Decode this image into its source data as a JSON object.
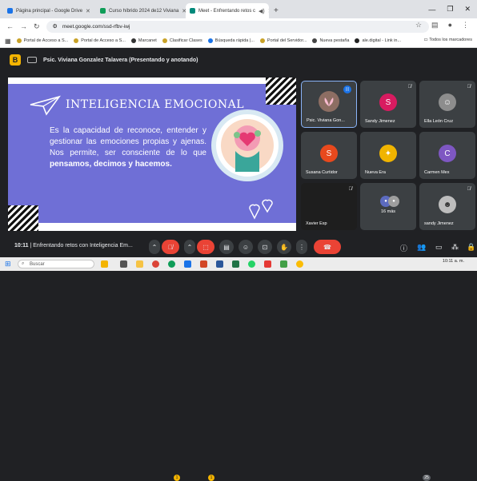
{
  "browser": {
    "tabs": [
      {
        "label": "Página principal - Google Drive",
        "color": "#1a73e8"
      },
      {
        "label": "Curso híbrido 2024 de12 Viviana",
        "color": "#0f9d58"
      },
      {
        "label": "Meet - Enfrentando retos c",
        "color": "#00897b",
        "active": true
      }
    ],
    "new_tab": "+",
    "url": "meet.google.com/ssd-rfbv-iwj",
    "bookmarks": [
      "Portal de Acceso a S...",
      "Portal de Acceso a S...",
      "Marcanet",
      "Clasificar Clases",
      "Búsqueda rápida |...",
      "Portal del Servidor...",
      "Nueva pestaña",
      "ale.digital - Link in..."
    ],
    "bookmarks_right": "Todos los marcadores"
  },
  "meet": {
    "badge": "B",
    "presenter_title": "Psic. Viviana Gonzalez Talavera (Presentando y anotando)",
    "slide": {
      "title": "INTELIGENCIA EMOCIONAL",
      "body_plain": "Es la capacidad de reconoce, entender y gestionar las emociones propias y ajenas. Nos permite, ser consciente de lo que ",
      "body_bold1": "pensamos, decimos y hacemos."
    },
    "participants": [
      {
        "name": "Psic. Viviana Gon...",
        "avatar": "",
        "color": "#5f6368",
        "active": true
      },
      {
        "name": "Sandy Jimenez",
        "avatar": "S",
        "color": "#d81b60"
      },
      {
        "name": "Ella León Cruz",
        "avatar": "",
        "color": "#8d8d8d"
      },
      {
        "name": "Susana Curtidor",
        "avatar": "S",
        "color": "#e8491d"
      },
      {
        "name": "Nueva Era",
        "avatar": "",
        "color": "#f0b400"
      },
      {
        "name": "Carmen Mex",
        "avatar": "C",
        "color": "#7e57c2"
      },
      {
        "name": "Xavier Esp",
        "avatar": "",
        "color": "#2b2b2b"
      },
      {
        "name": "16 más",
        "avatar": "",
        "color": "#5c6bc0"
      },
      {
        "name": "sandy Jimenez",
        "avatar": "",
        "color": "#9e9e9e"
      }
    ],
    "time": "10:11",
    "separator": "|",
    "meeting_name": "Enfrentando retos con Inteligencia Em...",
    "notif_count_1": "1",
    "notif_count_2": "1",
    "people_count": "25"
  },
  "taskbar": {
    "search_placeholder": "Buscar",
    "clock": "10:11 a. m."
  }
}
